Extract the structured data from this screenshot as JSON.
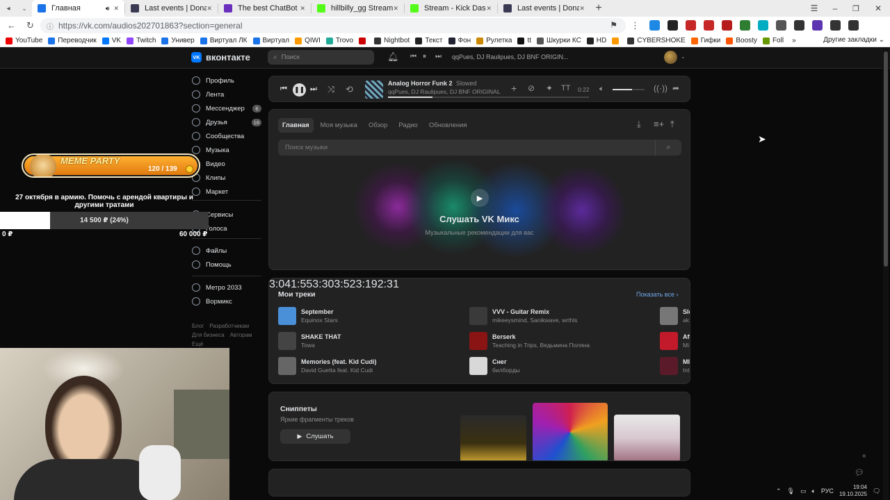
{
  "browser": {
    "tabs": [
      {
        "title": "Главная",
        "active": true,
        "color": "#1a73e8"
      },
      {
        "title": "Last events | DonatePay",
        "color": "#3a3a55"
      },
      {
        "title": "The best ChatBot and Wid",
        "color": "#6b2fbd"
      },
      {
        "title": "hillbilly_gg Stream - Watch",
        "color": "#53fc18"
      },
      {
        "title": "Stream - Kick Dashboard",
        "color": "#53fc18"
      },
      {
        "title": "Last events | DonatePay",
        "color": "#3a3a55"
      }
    ],
    "url": "https://vk.com/audios202701863?section=general",
    "bookmarks": [
      "YouTube",
      "Переводчик",
      "VK",
      "Twitch",
      "Универ",
      "Виртуал ЛК",
      "Виртуал",
      "QIWI",
      "Trovo",
      "",
      "Nightbot",
      "Текст",
      "Фон",
      "Рулетка",
      "tt",
      "Шкурки КС",
      "HD",
      "",
      "CYBERSHOKE",
      "Гифки",
      "Boosty",
      "Foll"
    ],
    "other_bookmarks": "Другие закладки"
  },
  "vk": {
    "logo": "вконтакте",
    "search_placeholder": "Поиск",
    "header_track": "qqPues, DJ Raulipues, DJ BNF ORIGIN...",
    "menu": [
      {
        "label": "Профиль"
      },
      {
        "label": "Лента"
      },
      {
        "label": "Мессенджер",
        "count": "6"
      },
      {
        "label": "Друзья",
        "count": "16"
      },
      {
        "label": "Сообщества"
      },
      {
        "label": "Музыка"
      },
      {
        "label": "Видео"
      },
      {
        "label": "Клипы"
      },
      {
        "label": "Маркет"
      }
    ],
    "menu2": [
      {
        "label": "Сервисы"
      },
      {
        "label": "Голоса"
      }
    ],
    "menu3": [
      {
        "label": "Файлы"
      },
      {
        "label": "Помощь"
      }
    ],
    "menu4": [
      {
        "label": "Метро 2033"
      },
      {
        "label": "Вормикс"
      }
    ],
    "footer_links": [
      "Блог",
      "Разработчикам",
      "Для бизнеса",
      "Авторам",
      "Ещё"
    ],
    "player": {
      "title": "Analog Horror Funk 2",
      "tag": "Slowed",
      "artist": "qqPues, DJ Raulipues, DJ BNF ORIGINAL",
      "time": "0:22",
      "progress": 0.22,
      "volume": 0.6
    },
    "music_tabs": [
      "Главная",
      "Моя музыка",
      "Обзор",
      "Радио",
      "Обновления"
    ],
    "music_search_placeholder": "Поиск музыки",
    "mix": {
      "title": "Слушать VK Микс",
      "subtitle": "Музыкальные рекомендации для вас"
    },
    "my_tracks": {
      "title": "Мои треки",
      "show_all": "Показать все",
      "col1": [
        {
          "name": "September",
          "artist": "Equinox Stars",
          "duration": "3:04",
          "color": "#4a90d9"
        },
        {
          "name": "SHAKE THAT",
          "artist": "Towa",
          "duration": "1:55",
          "color": "#444"
        },
        {
          "name": "Memories (feat. Kid Cudi)",
          "artist": "David Guetta feat. Kid Cudi",
          "duration": "3:30",
          "color": "#666"
        }
      ],
      "col2": [
        {
          "name": "VVV - Guitar Remix",
          "artist": "mikeeysmind, Sanikwave, wrthls",
          "duration": "3:52",
          "color": "#3a3a3a"
        },
        {
          "name": "Berserk",
          "artist": "Teaching in Trips, Ведьмина Поляна",
          "duration": "3:19",
          "color": "#8a1414"
        },
        {
          "name": "Снег",
          "artist": "билборды",
          "duration": "2:31",
          "color": "#d8d8d8"
        }
      ],
      "col3": [
        {
          "name": "Sle",
          "artist": "ak",
          "color": "#777"
        },
        {
          "name": "Aft",
          "artist": "Mi",
          "color": "#c21a2a"
        },
        {
          "name": "MI",
          "artist": "Int",
          "color": "#5a1a2a"
        }
      ]
    },
    "snippets": {
      "title": "Сниппеты",
      "subtitle": "Яркие фрагменты треков",
      "button": "Слушать"
    }
  },
  "overlay": {
    "meme_title": "MEME PARTY",
    "meme_count": "120 / 139",
    "goal_text": "27 октября в армию. Помочь с арендой квартиры и другими тратами",
    "goal_amount": "14 500 ₽ (24%)",
    "goal_progress": 0.24,
    "goal_min": "0 ₽",
    "goal_max": "60 000 ₽"
  },
  "taskbar": {
    "lang": "РУС",
    "time": "19:04",
    "date": "19.10.2025"
  }
}
